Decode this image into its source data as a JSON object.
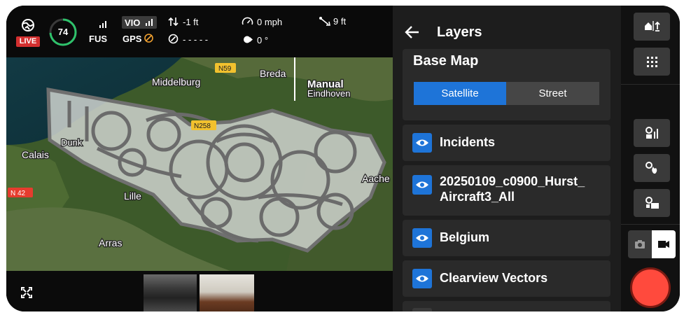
{
  "hud": {
    "live_label": "LIVE",
    "battery_percent": "74",
    "fus_label": "FUS",
    "vio_label": "VIO",
    "gps_label": "GPS",
    "altitude": "-1 ft",
    "heading": "- - - - -",
    "speed": "0 mph",
    "gimbal": "0 °",
    "distance": "9 ft"
  },
  "map": {
    "place_labels": [
      "Middelburg",
      "Breda",
      "Manual",
      "Eindhoven",
      "Calais",
      "Dunk",
      "Lille",
      "Aache",
      "Arras"
    ],
    "road_labels": [
      "N59",
      "N258",
      "N 42"
    ]
  },
  "panel": {
    "title": "Layers",
    "basemap": {
      "title": "Base Map",
      "options": [
        "Satellite",
        "Street"
      ],
      "selected": "Satellite"
    },
    "layers": [
      {
        "label": "Incidents",
        "visible": true
      },
      {
        "label": "20250109_c0900_Hurst_\nAircraft3_All",
        "visible": true
      },
      {
        "label": "Belgium",
        "visible": true
      },
      {
        "label": "Clearview Vectors",
        "visible": true
      }
    ]
  },
  "colors": {
    "accent_blue": "#1e74d8",
    "live_red": "#d32f2f",
    "record_red": "#ff4a3d",
    "battery_green": "#2ec26b"
  }
}
